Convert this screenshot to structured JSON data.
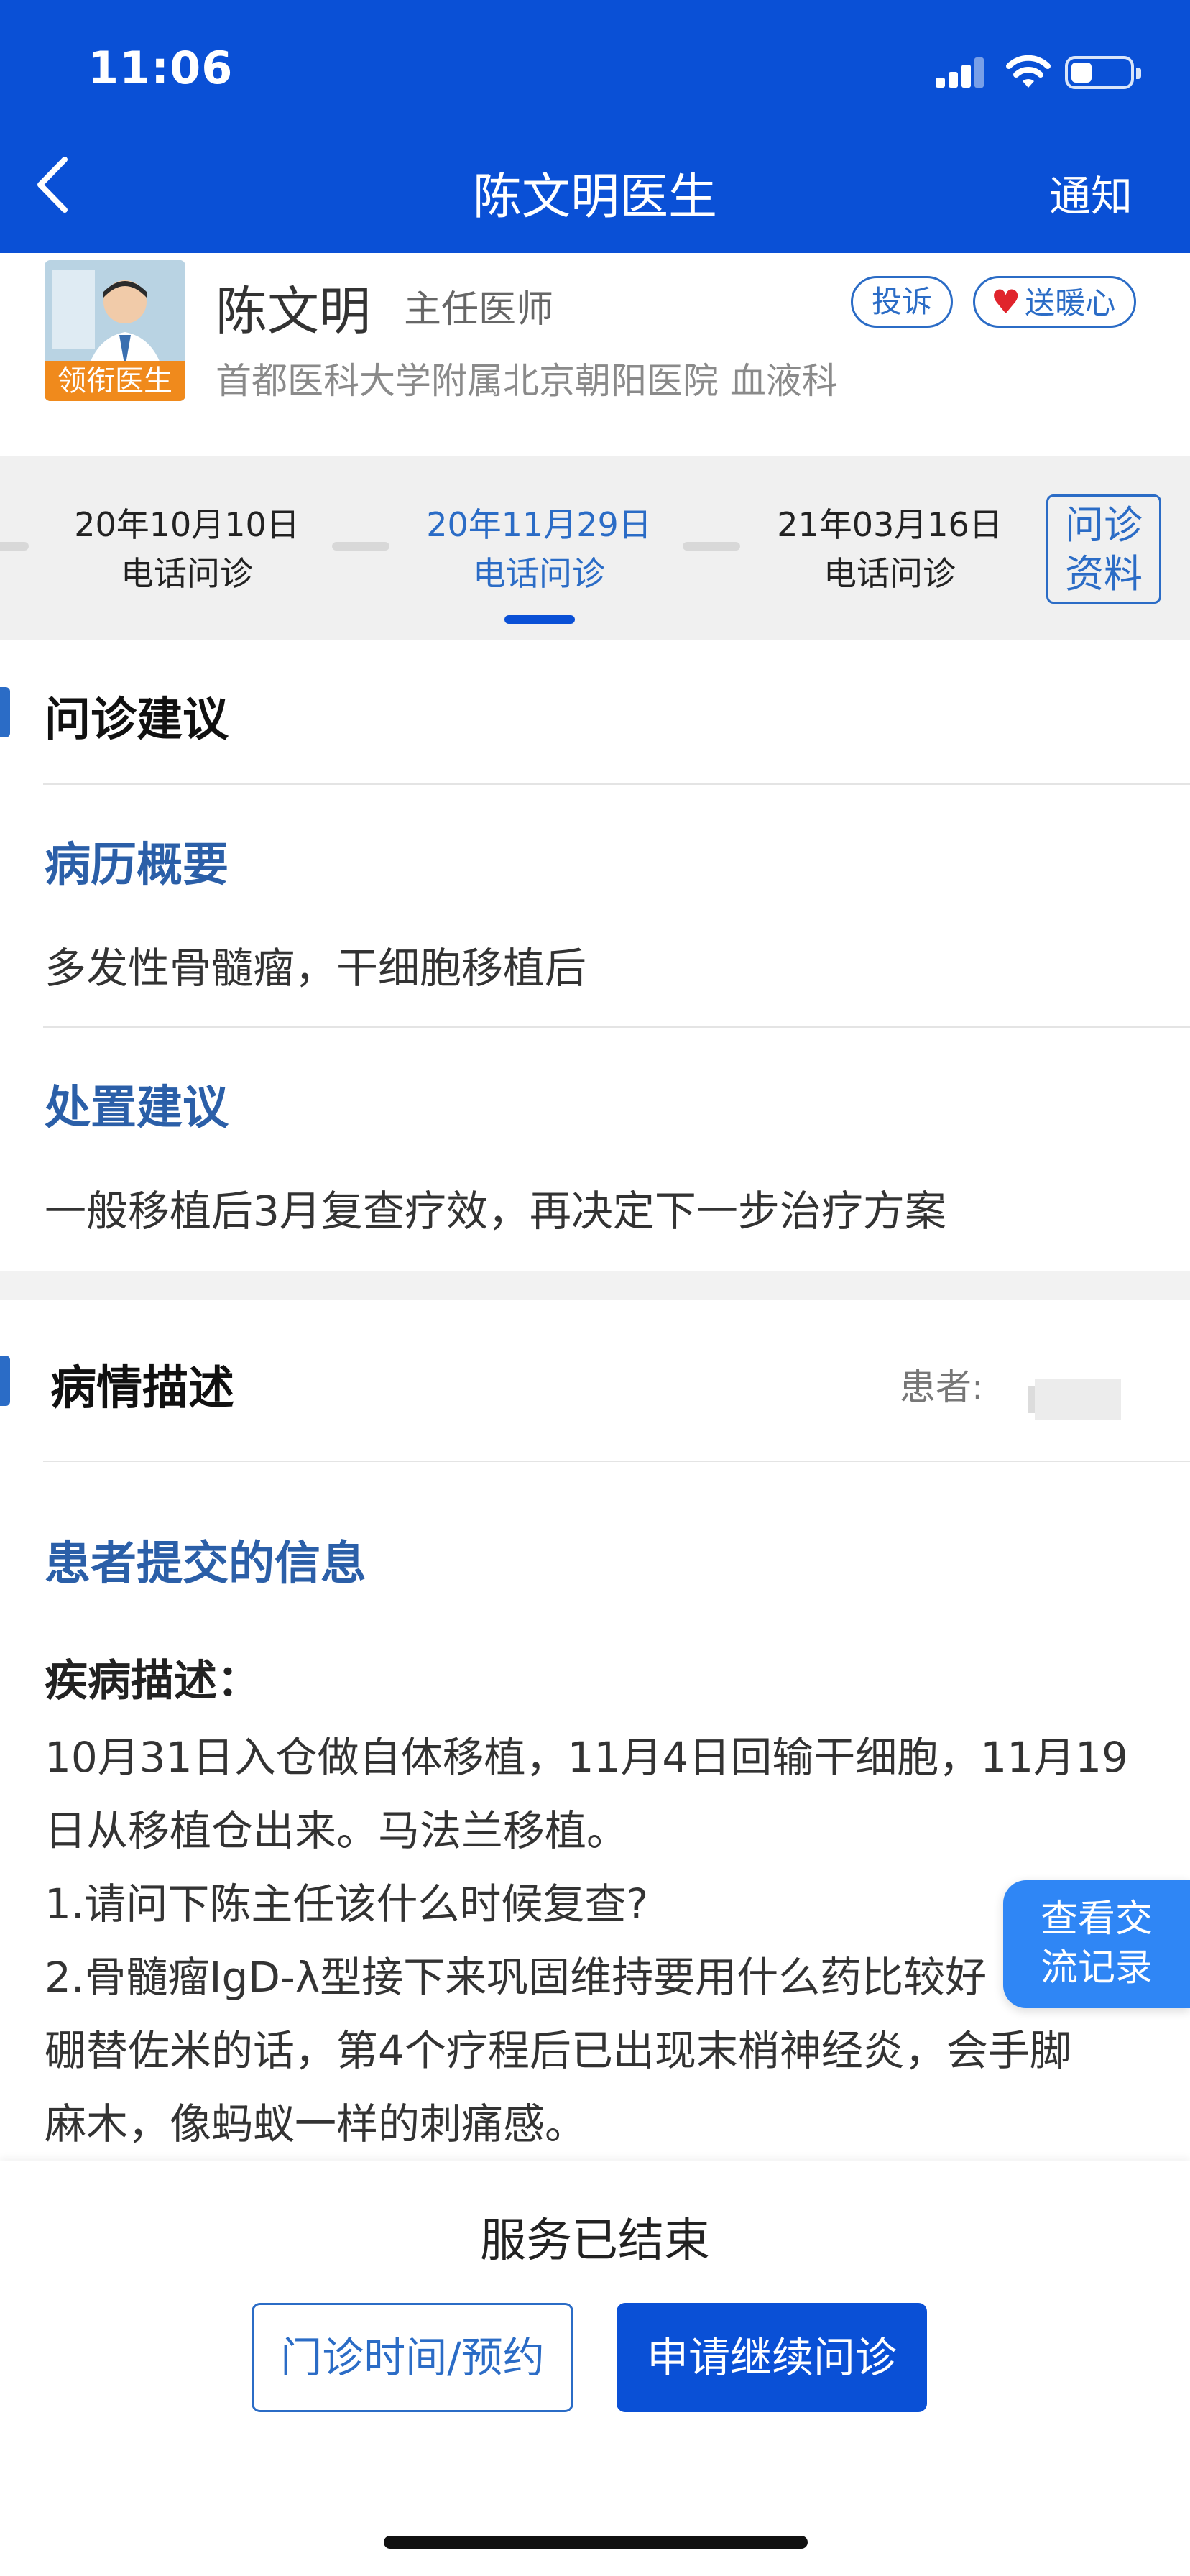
{
  "status_bar": {
    "time": "11:06"
  },
  "nav": {
    "title": "陈文明医生",
    "notice": "通知"
  },
  "doctor": {
    "avatar_badge": "领衔医生",
    "name": "陈文明",
    "title": "主任医师",
    "hospital": "首都医科大学附属北京朝阳医院 血液科",
    "complain": "投诉",
    "send_warmth": "送暖心"
  },
  "visits": [
    {
      "date": "20年10月10日",
      "type": "电话问诊"
    },
    {
      "date": "20年11月29日",
      "type": "电话问诊"
    },
    {
      "date": "21年03月16日",
      "type": "电话问诊"
    }
  ],
  "consult_info_button": [
    "问诊",
    "资料"
  ],
  "advice": {
    "section_title": "问诊建议",
    "history_title": "病历概要",
    "history_text": "多发性骨髓瘤，干细胞移植后",
    "disposal_title": "处置建议",
    "disposal_text": "一般移植后3月复查疗效，再决定下一步治疗方案"
  },
  "condition": {
    "section_title": "病情描述",
    "patient_label": "患者:",
    "submitted_title": "患者提交的信息",
    "desc_label": "疾病描述：",
    "desc_lines": [
      "10月31日入仓做自体移植，11月4日回输干细胞，11月19",
      "日从移植仓出来。马法兰移植。",
      "1.请问下陈主任该什么时候复查?",
      "2.骨髓瘤IgD-λ型接下来巩固维持要用什么药比较好",
      "硼替佐米的话，第4个疗程后已出现末梢神经炎，会手脚",
      "麻木，像蚂蚁一样的刺痛感。"
    ]
  },
  "float_button": [
    "查看交",
    "流记录"
  ],
  "bottom": {
    "status": "服务已结束",
    "clinic_button": "门诊时间/预约",
    "continue_button": "申请继续问诊"
  },
  "colors": {
    "brand_blue": "#0a50d6",
    "link_blue": "#2b6cc6",
    "badge_orange": "#f08a1c",
    "heart_red": "#e0242c"
  },
  "icons": [
    "back-chevron-icon",
    "signal-icon",
    "wifi-icon",
    "battery-icon",
    "heart-icon"
  ]
}
